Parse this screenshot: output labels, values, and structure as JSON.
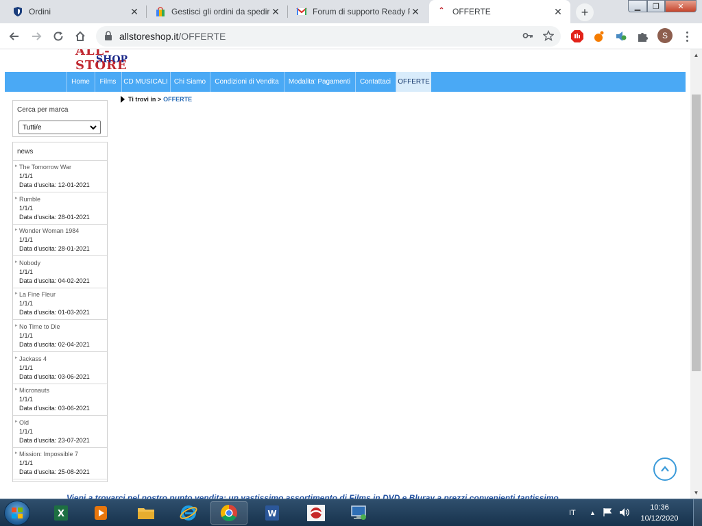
{
  "browser": {
    "tabs": [
      {
        "title": "Ordini",
        "icon": "shield-icon"
      },
      {
        "title": "Gestisci gli ordini da spedire",
        "icon": "shopping-bag-icon"
      },
      {
        "title": "Forum di supporto Ready Pro",
        "icon": "gmail-icon"
      },
      {
        "title": "OFFERTE",
        "icon": "page-icon"
      }
    ],
    "new_tab_symbol": "+",
    "url_host": "allstoreshop.it",
    "url_path": "/OFFERTE",
    "profile_initial": "S"
  },
  "site": {
    "logo_line1": "ALL-STORE",
    "logo_line2": "SHOP",
    "nav": [
      "Home",
      "Films",
      "CD MUSICALI",
      "Chi Siamo",
      "Condizioni di Vendita",
      "Modalita' Pagamenti",
      "Contattaci",
      "OFFERTE"
    ],
    "active_nav": "OFFERTE",
    "breadcrumb_prefix": "Ti trovi in >",
    "breadcrumb_current": "OFFERTE",
    "brand_filter": {
      "header": "Cerca per marca",
      "selected": "Tutti/e"
    },
    "news": {
      "header": "news",
      "items": [
        {
          "title": "The Tomorrow War",
          "sub": "1/1/1",
          "date": "Data d'uscita: 12-01-2021"
        },
        {
          "title": "Rumble",
          "sub": "1/1/1",
          "date": "Data d'uscita: 28-01-2021"
        },
        {
          "title": "Wonder Woman 1984",
          "sub": "1/1/1",
          "date": "Data d'uscita: 28-01-2021"
        },
        {
          "title": "Nobody",
          "sub": "1/1/1",
          "date": "Data d'uscita: 04-02-2021"
        },
        {
          "title": "La Fine Fleur",
          "sub": "1/1/1",
          "date": "Data d'uscita: 01-03-2021"
        },
        {
          "title": "No Time to Die",
          "sub": "1/1/1",
          "date": "Data d'uscita: 02-04-2021"
        },
        {
          "title": "Jackass 4",
          "sub": "1/1/1",
          "date": "Data d'uscita: 03-06-2021"
        },
        {
          "title": "Micronauts",
          "sub": "1/1/1",
          "date": "Data d'uscita: 03-06-2021"
        },
        {
          "title": "Old",
          "sub": "1/1/1",
          "date": "Data d'uscita: 23-07-2021"
        },
        {
          "title": "Mission: Impossible 7",
          "sub": "1/1/1",
          "date": "Data d'uscita: 25-08-2021"
        }
      ]
    },
    "bottom_text": "Vieni a trovarci nel nostro punto vendita: un vastissimo assortimento di Films in DVD e Bluray a prezzi convenienti tantissimo..."
  },
  "taskbar": {
    "apps": [
      "excel-icon",
      "media-player-icon",
      "file-explorer-icon",
      "internet-explorer-icon",
      "chrome-icon",
      "word-icon",
      "readypro-icon",
      "remote-desktop-icon"
    ],
    "language": "IT",
    "time": "10:36",
    "date": "10/12/2020"
  },
  "colors": {
    "nav_bg": "#4aa9f5",
    "link_blue": "#2a6db7",
    "logo_red": "#c0262e",
    "logo_navy": "#1d2a8a"
  }
}
